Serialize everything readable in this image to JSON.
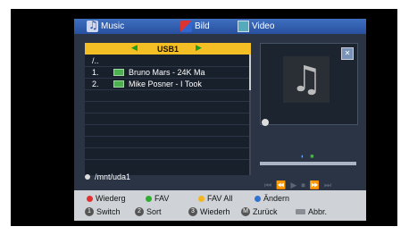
{
  "tabs": [
    {
      "label": "Music"
    },
    {
      "label": "Bild"
    },
    {
      "label": "Video"
    }
  ],
  "list": {
    "header": "USB1",
    "items": [
      {
        "num": "/..",
        "name": ""
      },
      {
        "num": "1.",
        "name": "Bruno Mars - 24K Ma"
      },
      {
        "num": "2.",
        "name": "Mike Posner - I Took"
      }
    ],
    "path": "/mnt/uda1"
  },
  "legend": {
    "row1": [
      {
        "label": "Wiederg",
        "color": "#e03030"
      },
      {
        "label": "FAV",
        "color": "#2fae2f"
      },
      {
        "label": "FAV All",
        "color": "#f2b622"
      },
      {
        "label": "Ändern",
        "color": "#2f72d0"
      }
    ],
    "row2": [
      {
        "key": "1",
        "label": "Switch"
      },
      {
        "key": "2",
        "label": "Sort"
      },
      {
        "key": "3",
        "label": "Wiederh"
      },
      {
        "key": "M",
        "label": "Zurück"
      },
      {
        "key": "",
        "label": "Abbr."
      }
    ]
  },
  "icons": {
    "music": "music-note-icon",
    "bild": "picture-icon",
    "video": "video-icon",
    "album": "♫",
    "mute": "speaker-mute-icon",
    "arrow_left": "◀",
    "arrow_right": "▶",
    "controls": [
      "⏮",
      "⏪",
      "▶",
      "⏹",
      "⏩",
      "⏭"
    ]
  }
}
